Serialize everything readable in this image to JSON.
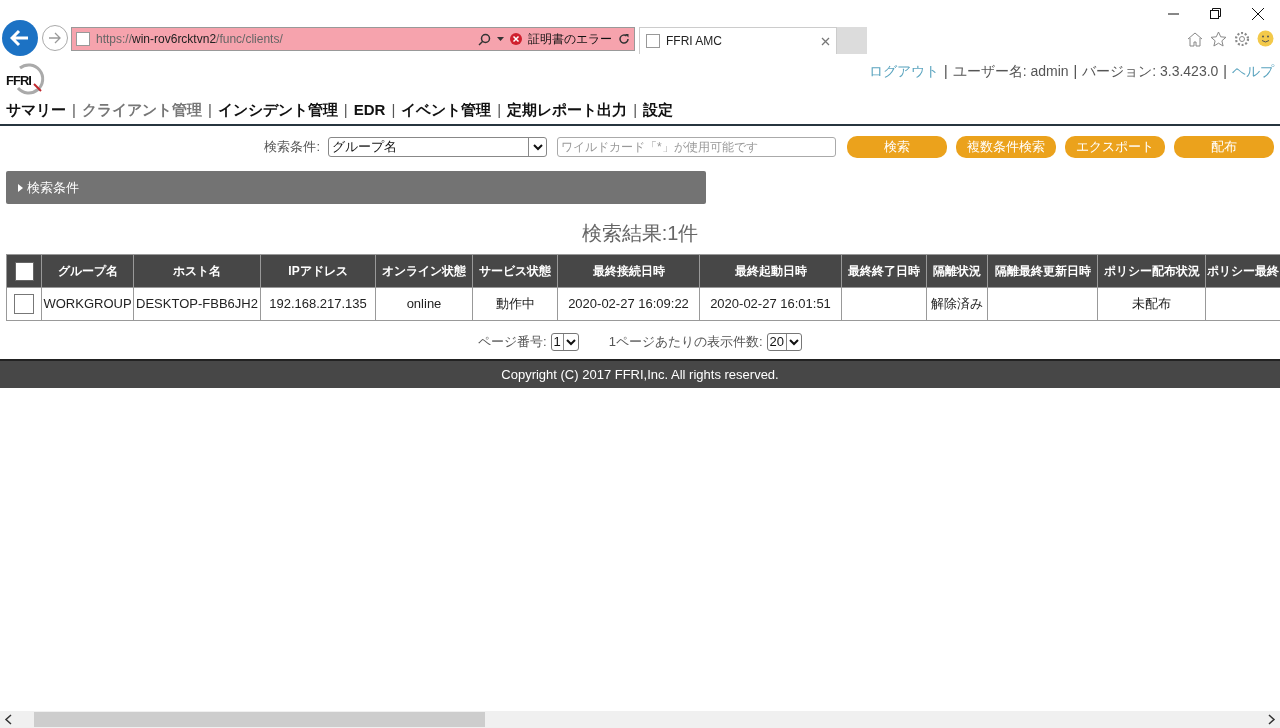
{
  "browser": {
    "url_prefix": "https://",
    "url_host": "win-rov6rcktvn2",
    "url_path": "/func/clients/",
    "cert_error": "証明書のエラー",
    "tab_title": "FFRI AMC"
  },
  "header": {
    "logo_text": "FFRI",
    "links": [
      {
        "kind": "link",
        "label": "ログアウト"
      },
      {
        "kind": "separator",
        "label": "|"
      },
      {
        "kind": "text",
        "label": "ユーザー名: admin"
      },
      {
        "kind": "separator",
        "label": "|"
      },
      {
        "kind": "text",
        "label": "バージョン: 3.3.423.0"
      },
      {
        "kind": "separator",
        "label": "|"
      },
      {
        "kind": "link",
        "label": "ヘルプ"
      }
    ]
  },
  "nav": [
    {
      "kind": "item",
      "label": "サマリー",
      "selected": false
    },
    {
      "kind": "separator",
      "label": "|"
    },
    {
      "kind": "item",
      "label": "クライアント管理",
      "selected": true
    },
    {
      "kind": "separator",
      "label": "|"
    },
    {
      "kind": "item",
      "label": "インシデント管理",
      "selected": false
    },
    {
      "kind": "separator",
      "label": "|"
    },
    {
      "kind": "item",
      "label": "EDR",
      "selected": false
    },
    {
      "kind": "separator",
      "label": "|"
    },
    {
      "kind": "item",
      "label": "イベント管理",
      "selected": false
    },
    {
      "kind": "separator",
      "label": "|"
    },
    {
      "kind": "item",
      "label": "定期レポート出力",
      "selected": false
    },
    {
      "kind": "separator",
      "label": "|"
    },
    {
      "kind": "item",
      "label": "設定",
      "selected": false
    }
  ],
  "search": {
    "label": "検索条件:",
    "select_value": "グループ名",
    "placeholder": "ワイルドカード「*」が使用可能です",
    "buttons": [
      "検索",
      "複数条件検索",
      "エクスポート",
      "配布"
    ]
  },
  "panel": {
    "title": "検索条件",
    "expanded": false
  },
  "result_title": "検索結果:1件",
  "table": {
    "header_checked": false,
    "columns": [
      "グループ名",
      "ホスト名",
      "IPアドレス",
      "オンライン状態",
      "サービス状態",
      "最終接続日時",
      "最終起動日時",
      "最終終了日時",
      "隔離状況",
      "隔離最終更新日時",
      "ポリシー配布状況",
      "ポリシー最終"
    ],
    "rows": [
      {
        "checked": false,
        "cells": [
          "WORKGROUP",
          "DESKTOP-FBB6JH2",
          "192.168.217.135",
          "online",
          "動作中",
          "2020-02-27 16:09:22",
          "2020-02-27 16:01:51",
          "",
          "解除済み",
          "",
          "未配布",
          ""
        ]
      }
    ]
  },
  "pagination": {
    "page_label": "ページ番号:",
    "page_value": "1",
    "per_page_label": "1ページあたりの表示件数:",
    "per_page_value": "20"
  },
  "footer": "Copyright (C) 2017 FFRI,Inc. All rights reserved."
}
